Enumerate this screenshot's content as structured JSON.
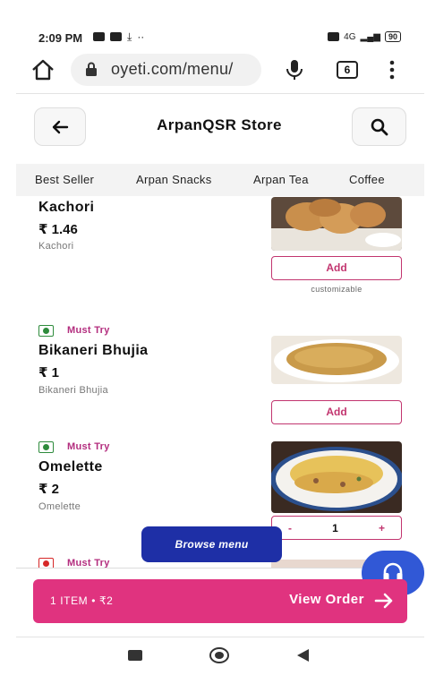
{
  "status_bar": {
    "time": "2:09 PM",
    "network": "4G",
    "battery": "90"
  },
  "browser": {
    "url": "oyeti.com/menu/",
    "tab_count": "6"
  },
  "header": {
    "title": "ArpanQSR Store"
  },
  "categories": [
    "Best Seller",
    "Arpan Snacks",
    "Arpan Tea",
    "Coffee"
  ],
  "items": [
    {
      "name": "Kachori",
      "price": "₹ 1.46",
      "description": "Kachori",
      "add_label": "Add",
      "note": "customizable"
    },
    {
      "badge": "Must Try",
      "name": "Bikaneri Bhujia",
      "price": "₹ 1",
      "description": "Bikaneri Bhujia",
      "add_label": "Add"
    },
    {
      "badge": "Must Try",
      "name": "Omelette",
      "price": "₹ 2",
      "description": "Omelette",
      "qty": "1",
      "minus": "-",
      "plus": "+"
    },
    {
      "badge": "Must Try"
    }
  ],
  "browse_menu": "Browse menu",
  "order_bar": {
    "summary": "1 ITEM • ₹2",
    "cta": "View Order"
  },
  "colors": {
    "accent": "#e0337f",
    "browse": "#1e2fa6",
    "help": "#3158d6",
    "veg": "#2e8b3c",
    "nonveg": "#d62828"
  },
  "icons": {
    "home": "home-icon",
    "lock": "lock-icon",
    "mic": "mic-icon",
    "more": "more-vert-icon",
    "back": "arrow-left-icon",
    "search": "search-icon",
    "help": "headset-icon",
    "order_arrow": "arrow-right-icon"
  }
}
